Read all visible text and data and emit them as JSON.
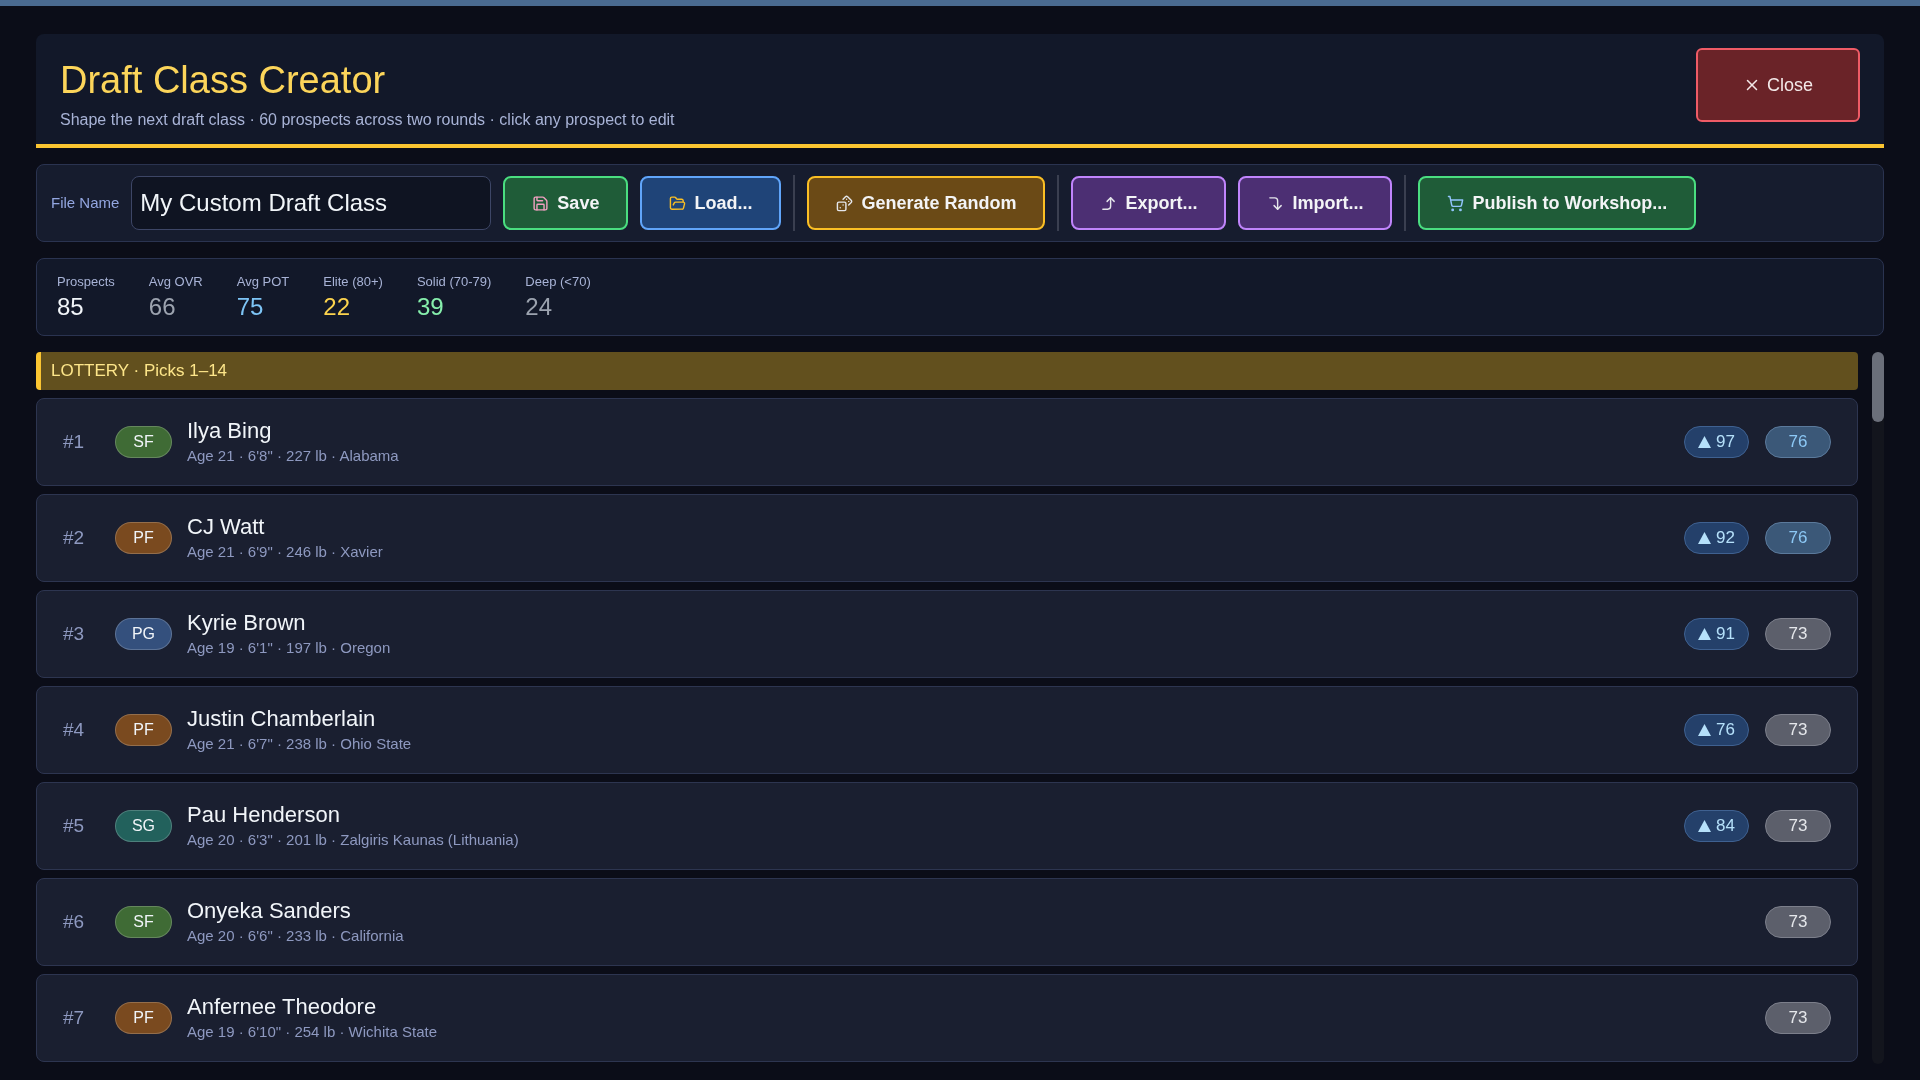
{
  "header": {
    "title": "Draft Class Creator",
    "subtitle": "Shape the next draft class · 60 prospects across two rounds · click any prospect to edit",
    "close_label": "Close"
  },
  "toolbar": {
    "file_label": "File Name",
    "file_value": "My Custom Draft Class",
    "button_groups": [
      [
        {
          "kind": "save",
          "label": "Save"
        },
        {
          "kind": "load",
          "label": "Load..."
        }
      ],
      [
        {
          "kind": "random",
          "label": "Generate Random"
        }
      ],
      [
        {
          "kind": "export",
          "label": "Export..."
        },
        {
          "kind": "import",
          "label": "Import..."
        }
      ],
      [
        {
          "kind": "publish",
          "label": "Publish to Workshop..."
        }
      ]
    ]
  },
  "stats": [
    {
      "label": "Prospects",
      "value": "85",
      "color": "#f1f5f9"
    },
    {
      "label": "Avg OVR",
      "value": "66",
      "color": "#9ca3af"
    },
    {
      "label": "Avg POT",
      "value": "75",
      "color": "#7dc4f5"
    },
    {
      "label": "Elite (80+)",
      "value": "22",
      "color": "#fcd34d"
    },
    {
      "label": "Solid (70-79)",
      "value": "39",
      "color": "#86efac"
    },
    {
      "label": "Deep (<70)",
      "value": "24",
      "color": "#9ca3af"
    }
  ],
  "section": {
    "title": "LOTTERY · Picks 1–14"
  },
  "prospects": [
    {
      "pick": "#1",
      "position": {
        "label": "SF",
        "color": "#3f6b35"
      },
      "name": "Ilya Bing",
      "details": "Age 21 · 6'8\" · 227 lb · Alabama",
      "potential": "97",
      "rating": {
        "value": "76",
        "kind": "high"
      }
    },
    {
      "pick": "#2",
      "position": {
        "label": "PF",
        "color": "#7a4a1f"
      },
      "name": "CJ Watt",
      "details": "Age 21 · 6'9\" · 246 lb · Xavier",
      "potential": "92",
      "rating": {
        "value": "76",
        "kind": "high"
      }
    },
    {
      "pick": "#3",
      "position": {
        "label": "PG",
        "color": "#34507d"
      },
      "name": "Kyrie Brown",
      "details": "Age 19 · 6'1\" · 197 lb · Oregon",
      "potential": "91",
      "rating": {
        "value": "73",
        "kind": "mid"
      }
    },
    {
      "pick": "#4",
      "position": {
        "label": "PF",
        "color": "#7a4a1f"
      },
      "name": "Justin Chamberlain",
      "details": "Age 21 · 6'7\" · 238 lb · Ohio State",
      "potential": "76",
      "rating": {
        "value": "73",
        "kind": "mid"
      }
    },
    {
      "pick": "#5",
      "position": {
        "label": "SG",
        "color": "#22615c"
      },
      "name": "Pau Henderson",
      "details": "Age 20 · 6'3\" · 201 lb · Zalgiris Kaunas (Lithuania)",
      "potential": "84",
      "rating": {
        "value": "73",
        "kind": "mid"
      }
    },
    {
      "pick": "#6",
      "position": {
        "label": "SF",
        "color": "#3f6b35"
      },
      "name": "Onyeka Sanders",
      "details": "Age 20 · 6'6\" · 233 lb · California",
      "rating": {
        "value": "73",
        "kind": "mid"
      }
    },
    {
      "pick": "#7",
      "position": {
        "label": "PF",
        "color": "#7a4a1f"
      },
      "name": "Anfernee Theodore",
      "details": "Age 19 · 6'10\" · 254 lb · Wichita State",
      "rating": {
        "value": "73",
        "kind": "mid"
      }
    }
  ]
}
